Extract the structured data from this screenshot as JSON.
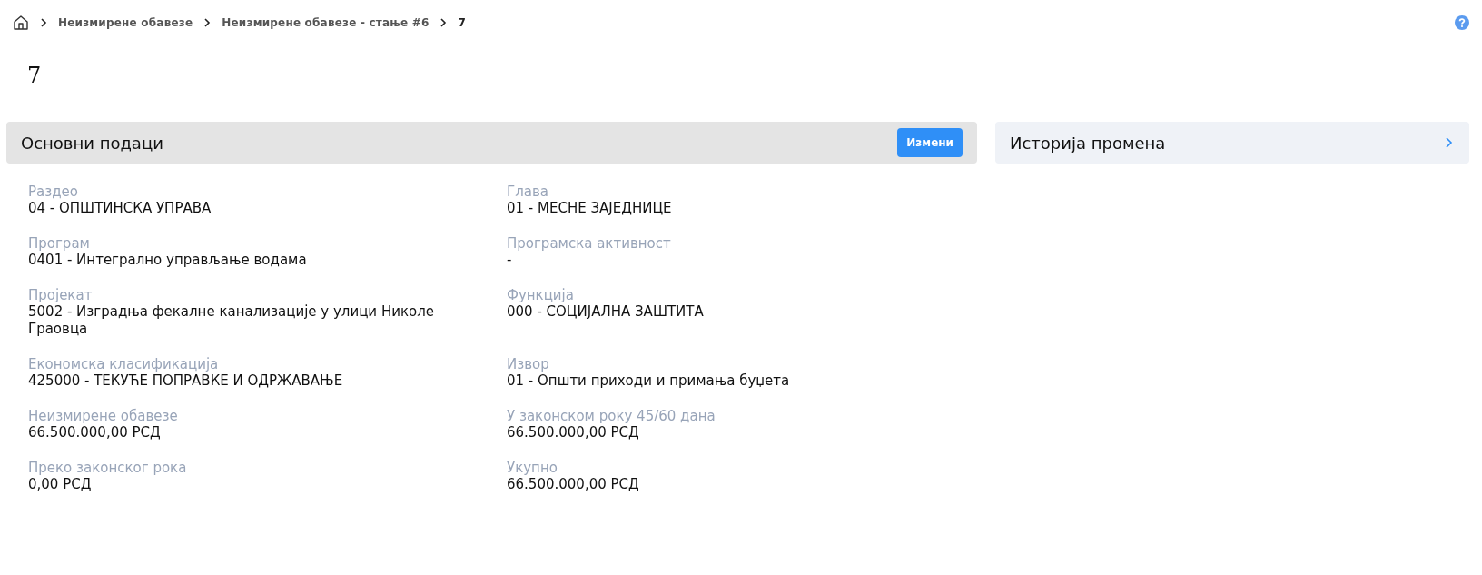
{
  "breadcrumbs": [
    {
      "label": "Неизмирене обавезе",
      "current": false
    },
    {
      "label": "Неизмирене обавезе - стање #6",
      "current": false
    },
    {
      "label": "7",
      "current": true
    }
  ],
  "title": "7",
  "main_panel": {
    "title": "Основни подаци",
    "edit_button": "Измени",
    "fields": [
      {
        "label": "Раздео",
        "value": "04 - ОПШТИНСКА УПРАВА"
      },
      {
        "label": "Глава",
        "value": "01 - МЕСНЕ ЗАЈЕДНИЦЕ"
      },
      {
        "label": "Програм",
        "value": "0401 - Интегрално управљање водама"
      },
      {
        "label": "Програмска активност",
        "value": "-"
      },
      {
        "label": "Пројекат",
        "value": "5002 - Изградња фекалне канализације у улици Николе Граовца"
      },
      {
        "label": "Функција",
        "value": "000 - СОЦИЈАЛНА ЗАШТИТА"
      },
      {
        "label": "Економска класификација",
        "value": "425000 - ТЕКУЋЕ ПОПРАВКЕ И ОДРЖАВАЊЕ"
      },
      {
        "label": "Извор",
        "value": "01 - Општи приходи и примања буџета"
      },
      {
        "label": "Неизмирене обавезе",
        "value": "66.500.000,00 РСД"
      },
      {
        "label": "У законском року 45/60 дана",
        "value": "66.500.000,00 РСД"
      },
      {
        "label": "Преко законског рока",
        "value": "0,00 РСД"
      },
      {
        "label": "Укупно",
        "value": "66.500.000,00 РСД"
      }
    ]
  },
  "history_panel": {
    "title": "Историја промена",
    "expanded": false
  }
}
